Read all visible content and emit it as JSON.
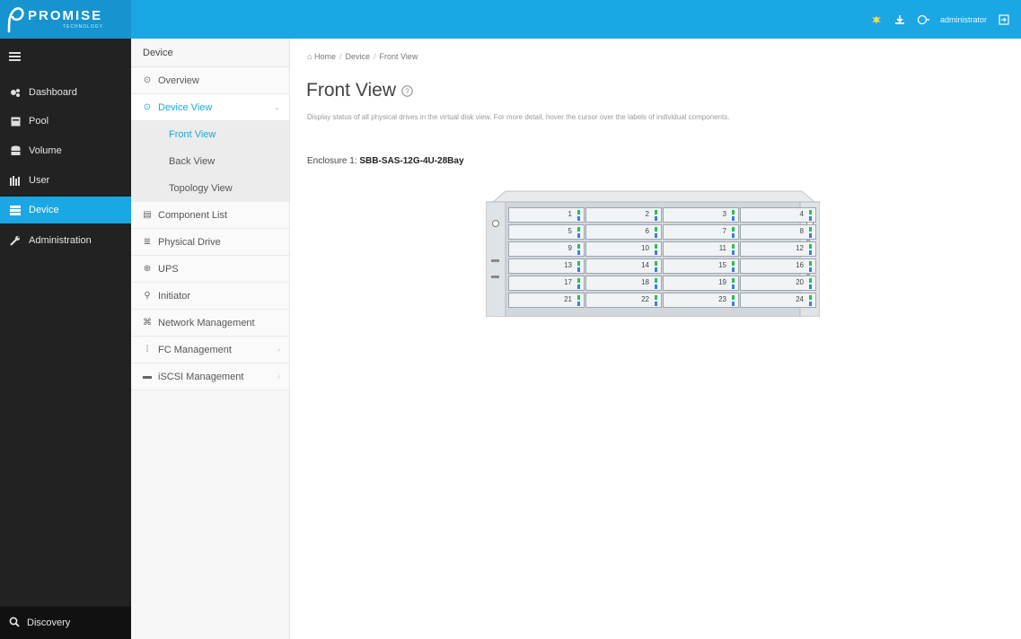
{
  "brand": {
    "name": "PROMISE",
    "sub": "TECHNOLOGY"
  },
  "topbar": {
    "user": "administrator"
  },
  "sidebar": {
    "items": [
      {
        "label": "Dashboard",
        "icon": "dashboard-icon"
      },
      {
        "label": "Pool",
        "icon": "pool-icon"
      },
      {
        "label": "Volume",
        "icon": "volume-icon"
      },
      {
        "label": "User",
        "icon": "user-icon"
      },
      {
        "label": "Device",
        "icon": "device-icon",
        "active": true
      },
      {
        "label": "Administration",
        "icon": "wrench-icon"
      }
    ],
    "discovery": "Discovery"
  },
  "submenu": {
    "title": "Device",
    "items": [
      {
        "label": "Overview"
      },
      {
        "label": "Device View",
        "open": true
      },
      {
        "label": "Front View"
      },
      {
        "label": "Back View"
      },
      {
        "label": "Topology View"
      },
      {
        "label": "Component List"
      },
      {
        "label": "Physical Drive"
      },
      {
        "label": "UPS"
      },
      {
        "label": "Initiator"
      },
      {
        "label": "Network Management"
      },
      {
        "label": "FC Management"
      },
      {
        "label": "iSCSI Management"
      }
    ]
  },
  "breadcrumb": {
    "home": "Home",
    "device": "Device",
    "current": "Front View"
  },
  "page": {
    "title": "Front View",
    "description": "Display status of all physical drives in the virtual disk view. For more detail, hover the cursor over the labels of individual components.",
    "enclosure_prefix": "Enclosure 1:",
    "enclosure_name": "SBB-SAS-12G-4U-28Bay"
  },
  "drives": [
    "1",
    "2",
    "3",
    "4",
    "5",
    "6",
    "7",
    "8",
    "9",
    "10",
    "11",
    "12",
    "13",
    "14",
    "15",
    "16",
    "17",
    "18",
    "19",
    "20",
    "21",
    "22",
    "23",
    "24"
  ],
  "colors": {
    "accent": "#1aa7e3",
    "sidebar": "#222222",
    "led_green": "#27c34a",
    "led_blue": "#3b7fe0"
  }
}
